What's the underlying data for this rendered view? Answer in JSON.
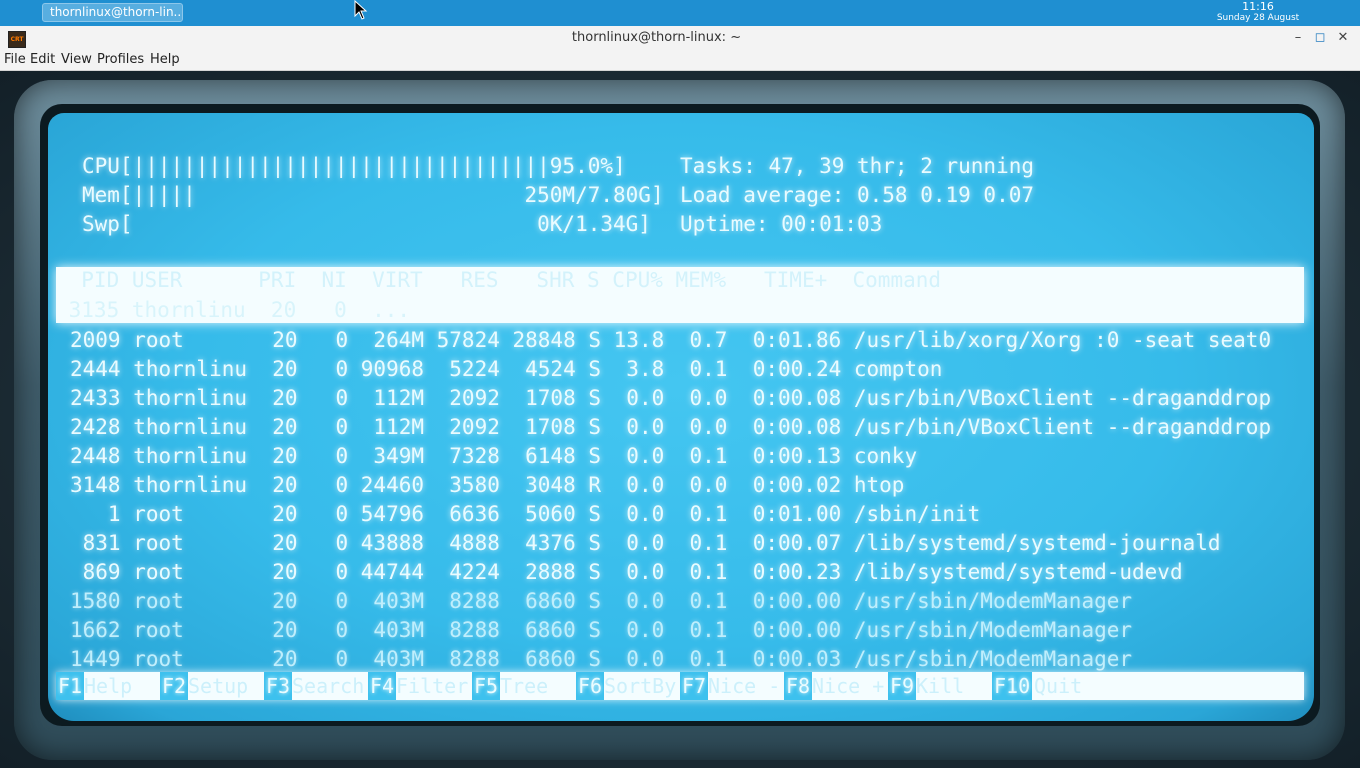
{
  "panel": {
    "task_label": "thornlinux@thorn-lin...",
    "clock_time": "11:16",
    "clock_date": "Sunday 28 August"
  },
  "window": {
    "title": "thornlinux@thorn-linux: ~",
    "app_icon_text": "CRT",
    "btn_min": "–",
    "btn_max": "◻",
    "btn_close": "✕"
  },
  "menu": [
    "File",
    "Edit",
    "View",
    "Profiles",
    "Help"
  ],
  "htop": {
    "cpu_line": "CPU[|||||||||||||||||||||||||||||||||95.0%]",
    "mem_line": "Mem[|||||                          250M/7.80G]",
    "swp_line": "Swp[                                0K/1.34G]",
    "tasks_line": "Tasks: 47, 39 thr; 2 running",
    "load_line": "Load average: 0.58 0.19 0.07",
    "uptime_line": "Uptime: 00:01:03",
    "header_line": "  PID USER      PRI  NI  VIRT   RES   SHR S CPU% MEM%   TIME+  Command",
    "selected_line": " 3135 thornlinu  20   0  ...",
    "processes": [
      "2009 root       20   0  264M 57824 28848 S 13.8  0.7  0:01.86 /usr/lib/xorg/Xorg :0 -seat seat0",
      "2444 thornlinu  20   0 90968  5224  4524 S  3.8  0.1  0:00.24 compton",
      "2433 thornlinu  20   0  112M  2092  1708 S  0.0  0.0  0:00.08 /usr/bin/VBoxClient --draganddrop",
      "2428 thornlinu  20   0  112M  2092  1708 S  0.0  0.0  0:00.08 /usr/bin/VBoxClient --draganddrop",
      "2448 thornlinu  20   0  349M  7328  6148 S  0.0  0.1  0:00.13 conky",
      "3148 thornlinu  20   0 24460  3580  3048 R  0.0  0.0  0:00.02 htop",
      "   1 root       20   0 54796  6636  5060 S  0.0  0.1  0:01.00 /sbin/init",
      " 831 root       20   0 43888  4888  4376 S  0.0  0.1  0:00.07 /lib/systemd/systemd-journald",
      " 869 root       20   0 44744  4224  2888 S  0.0  0.1  0:00.23 /lib/systemd/systemd-udevd",
      "1580 root       20   0  403M  8288  6860 S  0.0  0.1  0:00.00 /usr/sbin/ModemManager",
      "1662 root       20   0  403M  8288  6860 S  0.0  0.1  0:00.00 /usr/sbin/ModemManager",
      "1449 root       20   0  403M  8288  6860 S  0.0  0.1  0:00.03 /usr/sbin/ModemManager"
    ],
    "fkeys": [
      {
        "key": "F1",
        "label": "Help"
      },
      {
        "key": "F2",
        "label": "Setup"
      },
      {
        "key": "F3",
        "label": "Search"
      },
      {
        "key": "F4",
        "label": "Filter"
      },
      {
        "key": "F5",
        "label": "Tree"
      },
      {
        "key": "F6",
        "label": "SortBy"
      },
      {
        "key": "F7",
        "label": "Nice -"
      },
      {
        "key": "F8",
        "label": "Nice +"
      },
      {
        "key": "F9",
        "label": "Kill"
      },
      {
        "key": "F10",
        "label": "Quit"
      }
    ]
  },
  "colors": {
    "panel": "#1f8fd1",
    "screen": "#3bbfee",
    "bezel": "#4f6f7e"
  }
}
